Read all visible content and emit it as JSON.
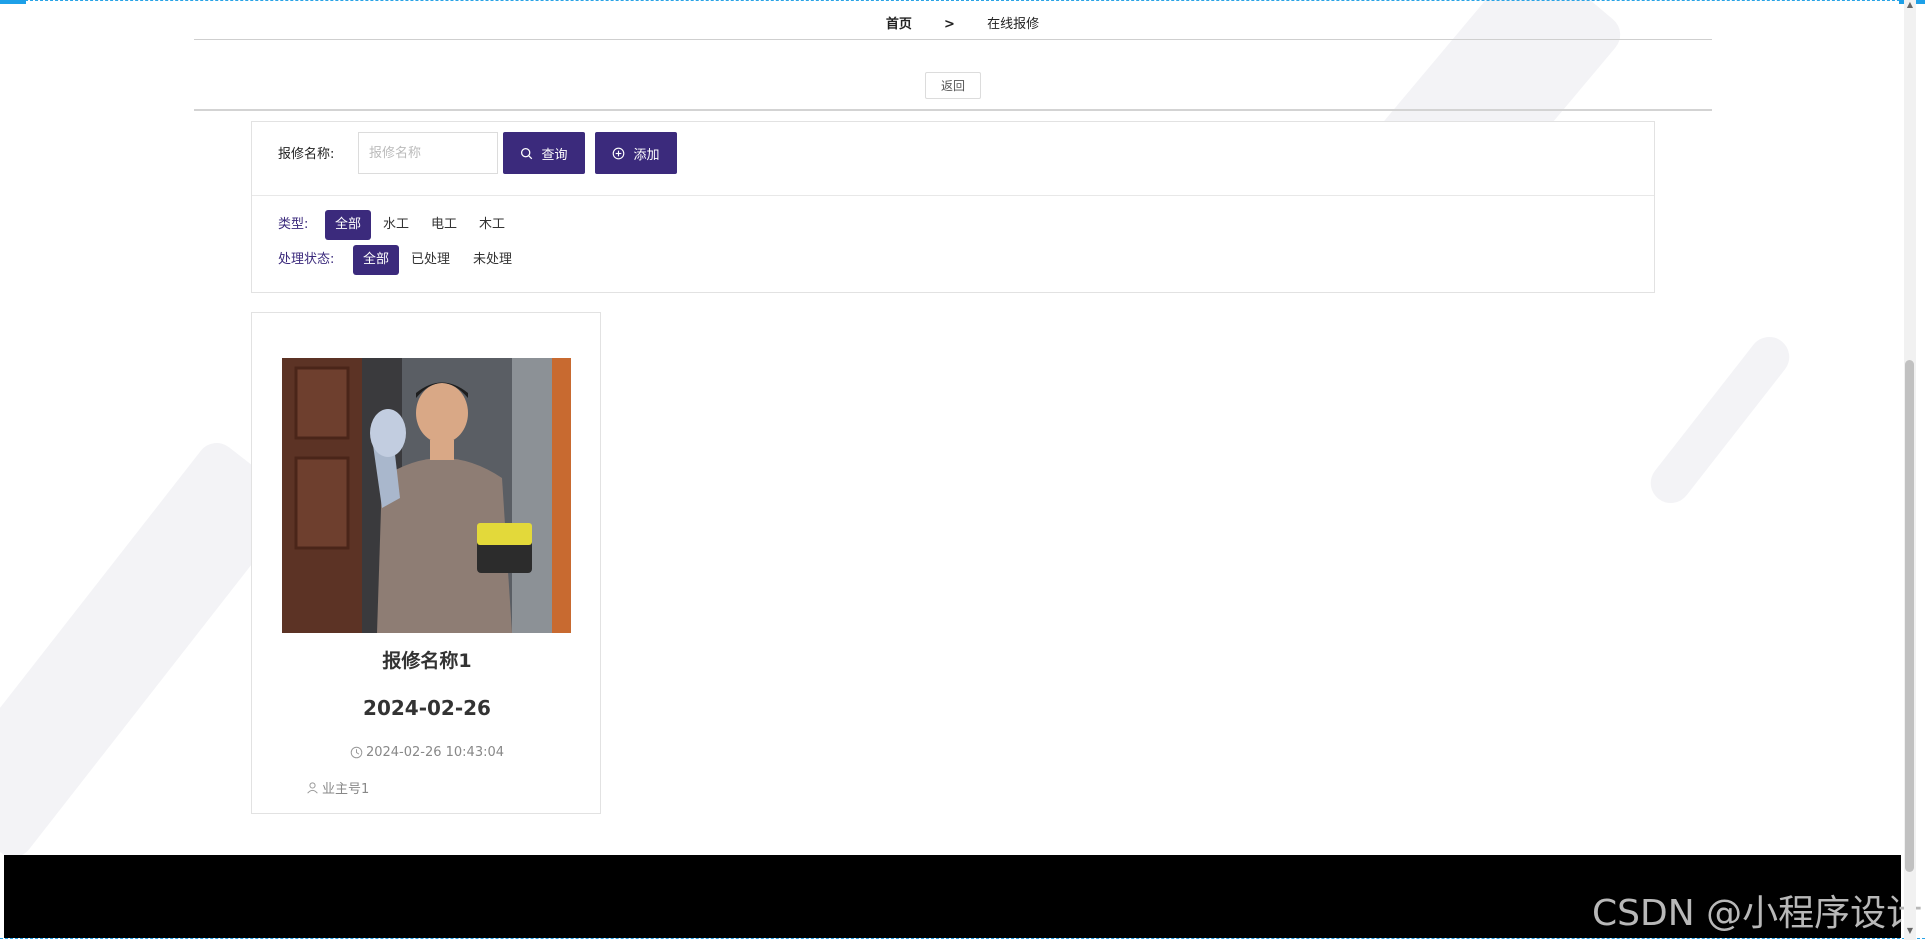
{
  "breadcrumb": {
    "home": "首页",
    "separator": ">",
    "current": "在线报修"
  },
  "back_button": "返回",
  "search": {
    "label": "报修名称:",
    "placeholder": "报修名称",
    "query_button": "查询",
    "add_button": "添加"
  },
  "filters": {
    "type": {
      "label": "类型:",
      "options": [
        "全部",
        "水工",
        "电工",
        "木工"
      ],
      "selected": "全部"
    },
    "status": {
      "label": "处理状态:",
      "options": [
        "全部",
        "已处理",
        "未处理"
      ],
      "selected": "全部"
    }
  },
  "cards": [
    {
      "title": "报修名称1",
      "date": "2024-02-26",
      "timestamp": "2024-02-26 10:43:04",
      "owner": "业主号1"
    }
  ],
  "watermark": "CSDN @小程序设计",
  "colors": {
    "primary": "#3b2a7c",
    "footer": "#000000",
    "accent_line": "#1da0e8"
  }
}
